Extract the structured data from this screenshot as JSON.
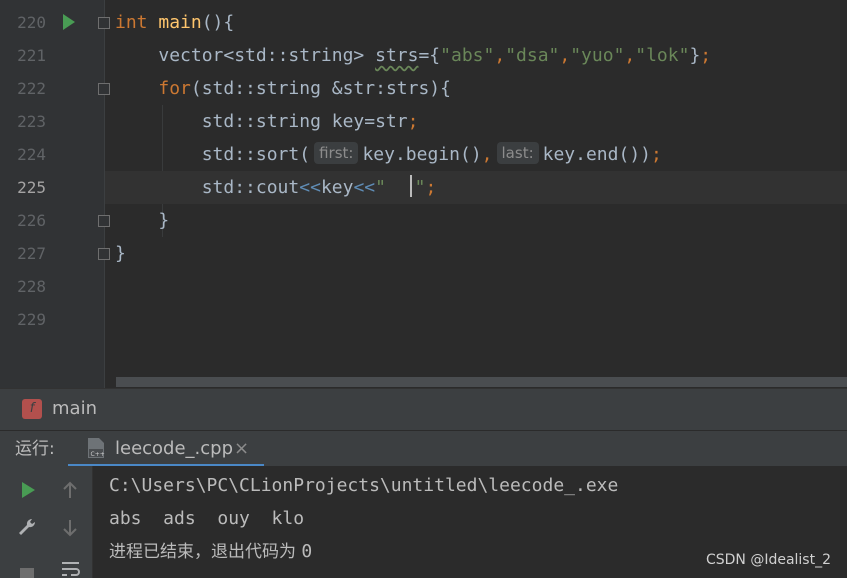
{
  "editor": {
    "line_numbers": [
      "220",
      "221",
      "222",
      "223",
      "224",
      "225",
      "226",
      "227",
      "228",
      "229"
    ],
    "active_line": "225",
    "lines": {
      "l220": {
        "kw": "int",
        "fn": "main",
        "rest": "(){"
      },
      "l221": {
        "type": "vector<std::string> ",
        "var": "strs",
        "eq": "={",
        "s1": "\"abs\"",
        "s2": "\"dsa\"",
        "s3": "\"yuo\"",
        "s4": "\"lok\"",
        "close": "}",
        "semi": ";"
      },
      "l222": {
        "kw": "for",
        "rest": "(std::string &str:strs){"
      },
      "l223": {
        "code": "std::string key=str",
        "semi": ";"
      },
      "l224": {
        "pre": "std::sort(",
        "hint_first": "first:",
        "mid": "key.begin()",
        "comma": ",",
        "hint_last": "last:",
        "post": "key.end())",
        "semi": ";"
      },
      "l225": {
        "pre": "std::cout",
        "op1": "<<",
        "mid": "key",
        "op2": "<<",
        "str_open": "\"  ",
        "str_close": "\"",
        "semi": ";"
      },
      "l226": {
        "code": "}"
      },
      "l227": {
        "code": "}"
      }
    }
  },
  "breadcrumb": {
    "icon_letter": "f",
    "label": "main"
  },
  "run_panel": {
    "label": "运行:",
    "tab_title": "leecode_.cpp",
    "tab_close": "×",
    "console": {
      "path": "C:\\Users\\PC\\CLionProjects\\untitled\\leecode_.exe",
      "output": "abs  ads  ouy  klo",
      "exit_text": "进程已结束，退出代码为 ",
      "exit_code": "0"
    }
  },
  "watermark": "CSDN @Idealist_2",
  "icons": {
    "run_gutter": "run-triangle-icon",
    "bulb": "intention-bulb-icon",
    "toolbar": [
      "rerun-icon",
      "up-arrow-icon",
      "wrench-icon",
      "down-arrow-icon",
      "stop-icon",
      "soft-wrap-icon"
    ]
  },
  "colors": {
    "keyword": "#cc7832",
    "function": "#ffc66d",
    "string": "#6a8759",
    "text": "#a9b7c6",
    "run_green": "#499c54",
    "tab_underline": "#4a88c7"
  }
}
